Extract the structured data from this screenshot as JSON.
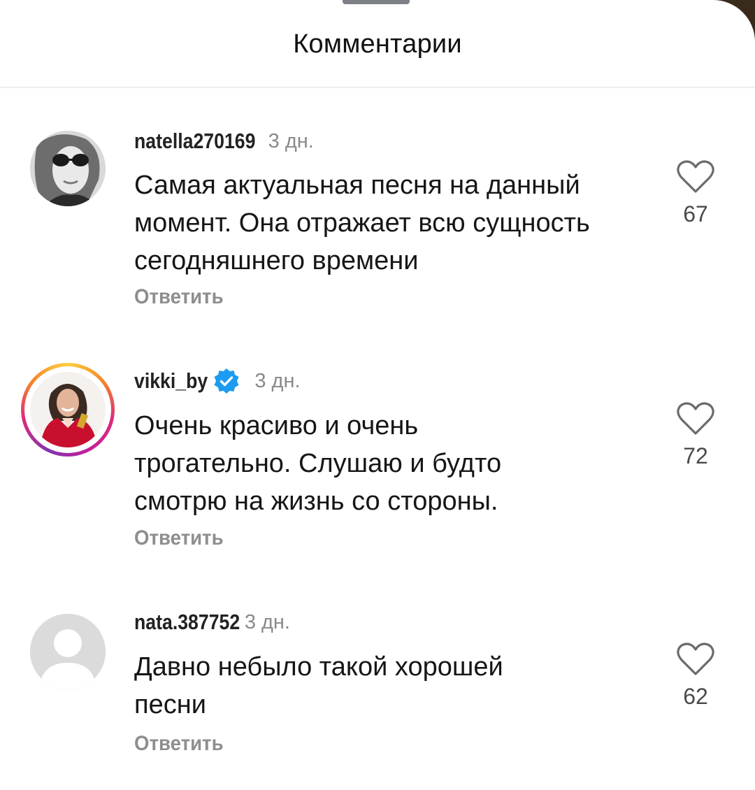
{
  "sheet": {
    "title": "Комментарии"
  },
  "comments": [
    {
      "username": "natella270169",
      "time": "3 дн.",
      "text": "Самая актуальная песня на данный момент. Она отражает всю сущность сегодняшнего времени",
      "reply_label": "Ответить",
      "likes": "67",
      "verified": false,
      "avatar": "photo-avatar-icon"
    },
    {
      "username": "vikki_by",
      "time": "3 дн.",
      "text": "Очень красиво и очень трогательно. Слушаю и будто смотрю на жизнь со стороны.",
      "reply_label": "Ответить",
      "likes": "72",
      "verified": true,
      "avatar": "photo-avatar-icon"
    },
    {
      "username": "nata.387752",
      "time": "3 дн.",
      "text": "Давно небыло такой хорошей песни",
      "reply_label": "Ответить",
      "likes": "62",
      "verified": false,
      "avatar": "default-user-avatar-icon"
    }
  ],
  "colors": {
    "verified_badge": "#1d9bf0",
    "secondary_text": "#8e8e8e",
    "story_ring": "#dd2a7b"
  }
}
